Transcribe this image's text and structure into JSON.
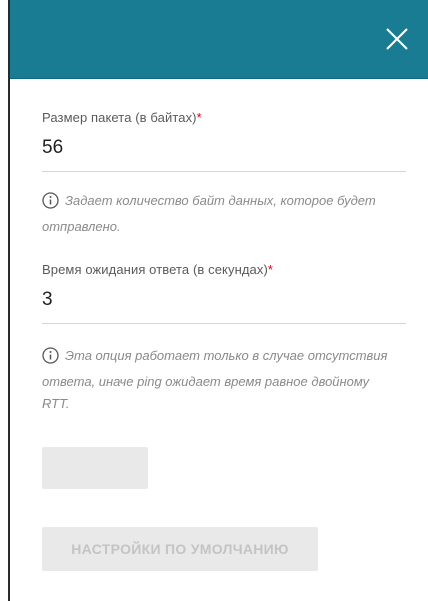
{
  "dialog": {
    "close_icon": "close-icon",
    "header_color": "#1a7c93"
  },
  "packet_size": {
    "label": "Размер пакета (в байтах)",
    "required_mark": "*",
    "value": "56",
    "hint": "Задает количество байт данных, которое будет отправлено."
  },
  "timeout": {
    "label": "Время ожидания ответа (в секундах)",
    "required_mark": "*",
    "value": "3",
    "hint": "Эта опция работает только в случае отсутствия ответа, иначе ping ожидает время равное двойному RTT."
  },
  "buttons": {
    "apply_label": "",
    "defaults_label": "НАСТРОЙКИ ПО УМОЛЧАНИЮ"
  }
}
